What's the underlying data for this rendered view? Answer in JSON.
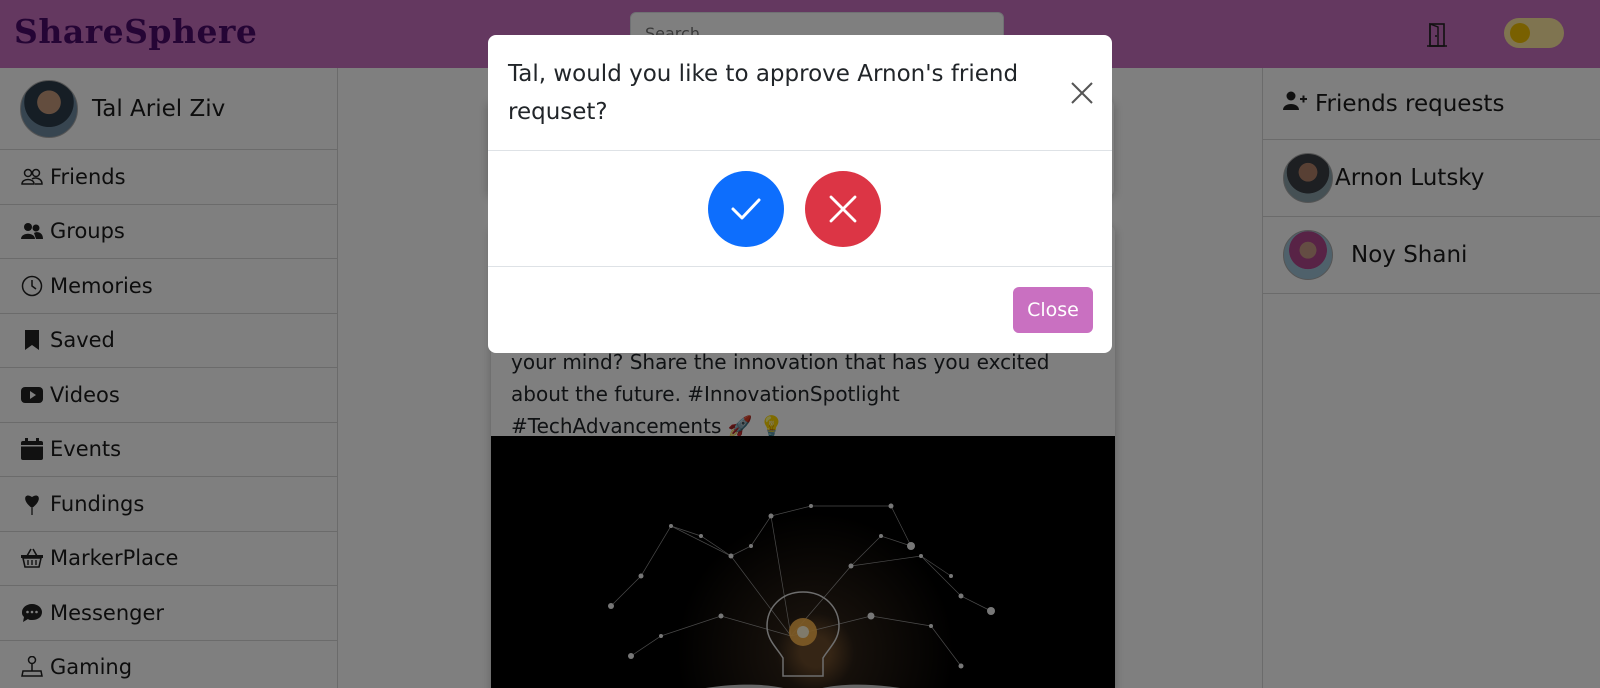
{
  "header": {
    "logo": "ShareSphere",
    "search_placeholder": "Search",
    "brand_color": "#c970c1",
    "logout_icon": "door-icon",
    "theme_toggle_icon": "sun-toggle"
  },
  "left_sidebar": {
    "user_name": "Tal Ariel Ziv",
    "items": [
      {
        "label": "Friends",
        "icon": "friends-icon"
      },
      {
        "label": "Groups",
        "icon": "groups-icon"
      },
      {
        "label": "Memories",
        "icon": "clock-icon"
      },
      {
        "label": "Saved",
        "icon": "bookmark-icon"
      },
      {
        "label": "Videos",
        "icon": "youtube-icon"
      },
      {
        "label": "Events",
        "icon": "calendar-icon"
      },
      {
        "label": "Fundings",
        "icon": "heart-balloon-icon"
      },
      {
        "label": "MarkerPlace",
        "icon": "basket-icon"
      },
      {
        "label": "Messenger",
        "icon": "chat-icon"
      },
      {
        "label": "Gaming",
        "icon": "joystick-icon"
      }
    ]
  },
  "feed": {
    "post_text": "your mind? Share the innovation that has you excited about the future. #InnovationSpotlight #TechAdvancements 🚀 💡"
  },
  "right_sidebar": {
    "title": "Friends requests",
    "requests": [
      {
        "name": "Arnon Lutsky"
      },
      {
        "name": "Noy Shani"
      }
    ]
  },
  "modal": {
    "title": "Tal, would you like to approve Arnon's friend requset?",
    "approve_icon": "check-icon",
    "decline_icon": "x-icon",
    "close_label": "Close",
    "approve_color": "#0d6efd",
    "decline_color": "#dc3545"
  }
}
